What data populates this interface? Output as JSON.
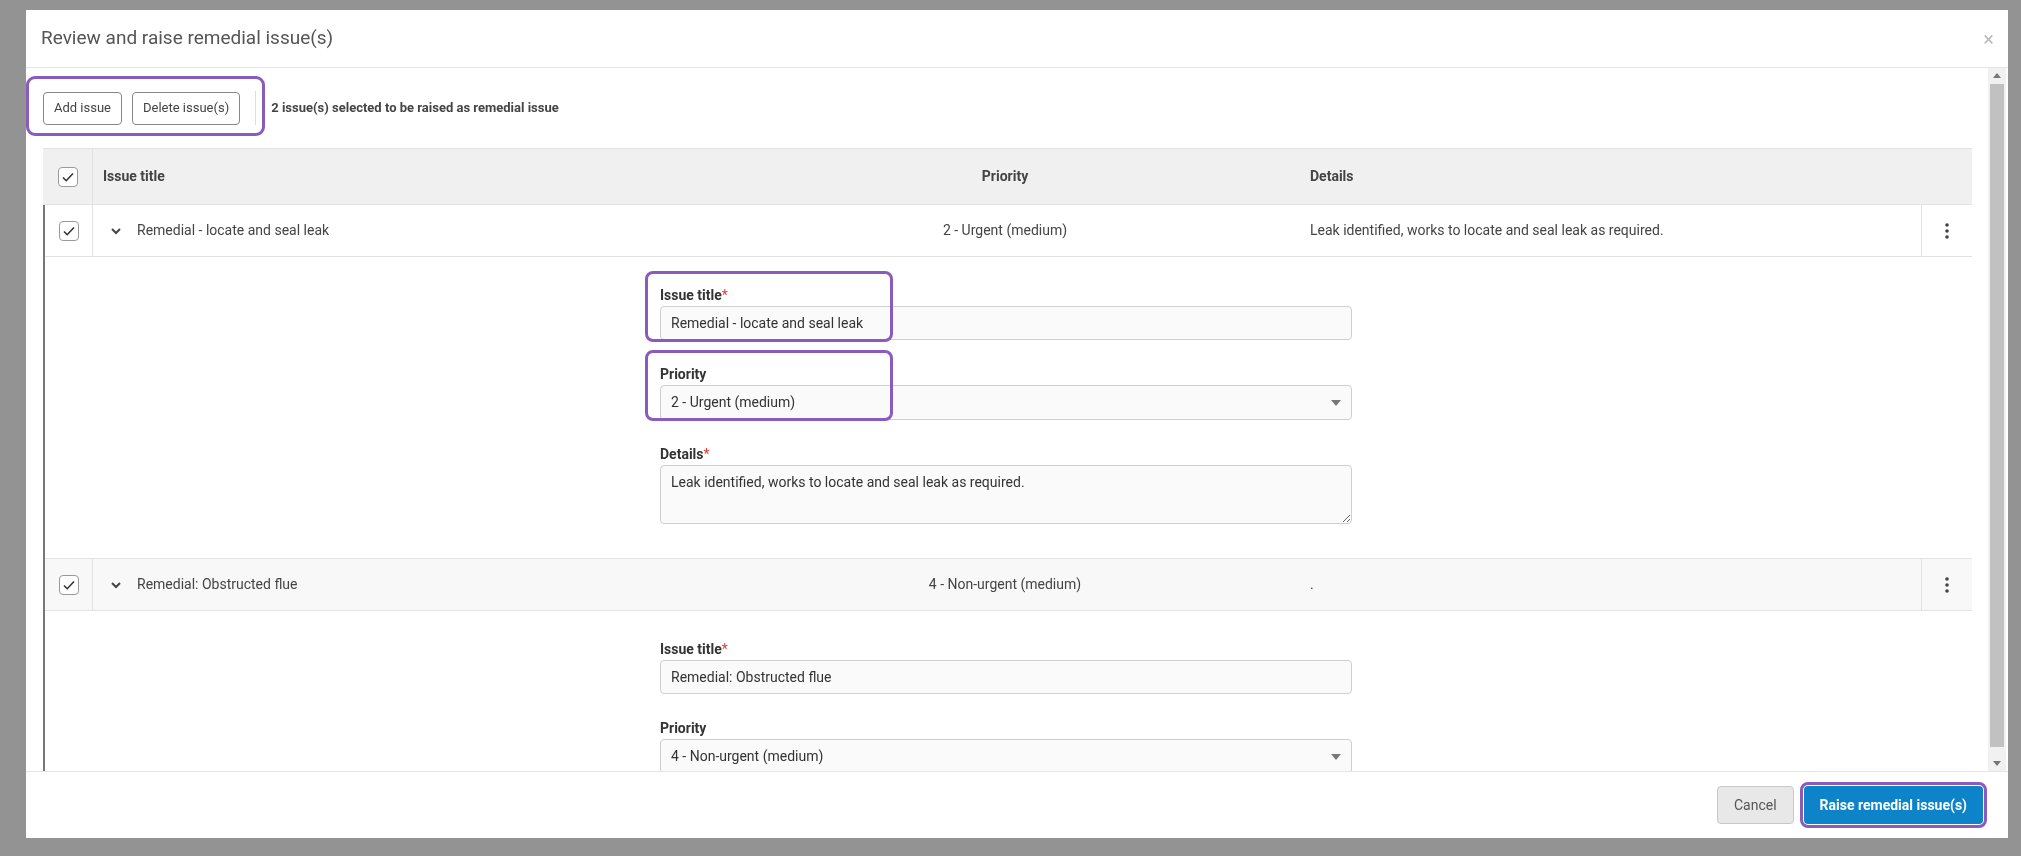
{
  "dialog": {
    "title": "Review and raise remedial issue(s)",
    "close": "×"
  },
  "toolbar": {
    "highlighted": true,
    "buttons": [
      "Add issue",
      "Delete issue(s)"
    ],
    "selection_note": "2 issue(s) selected to be raised as remedial issue"
  },
  "table": {
    "select_all_checked": true,
    "columns": [
      "Issue title",
      "Priority",
      "Details"
    ],
    "rows": [
      {
        "checked": true,
        "expanded": true,
        "title": "Remedial - locate and seal leak",
        "priority": "2 - Urgent (medium)",
        "details": "Leak identified, works to locate and seal leak as required.",
        "fields": [
          {
            "kind": "text",
            "label": "Issue title",
            "required_mark": "*",
            "highlighted": true,
            "value": "Remedial - locate and seal leak"
          },
          {
            "kind": "select",
            "label": "Priority",
            "highlighted": true,
            "value": "2 - Urgent (medium)"
          },
          {
            "kind": "textarea",
            "label": "Details",
            "required_mark": "*",
            "highlighted": false,
            "value": "Leak identified, works to locate and seal leak as required."
          }
        ]
      },
      {
        "checked": true,
        "expanded": true,
        "title": "Remedial: Obstructed flue",
        "priority": "4 - Non-urgent (medium)",
        "details": ".",
        "fields": [
          {
            "kind": "text",
            "label": "Issue title",
            "required_mark": "*",
            "highlighted": false,
            "value": "Remedial: Obstructed flue"
          },
          {
            "kind": "select",
            "label": "Priority",
            "highlighted": false,
            "value": "4 - Non-urgent (medium)"
          }
        ]
      }
    ]
  },
  "footer": {
    "buttons": [
      {
        "kind": "secondary",
        "label": "Cancel",
        "highlighted": false
      },
      {
        "kind": "primary",
        "label": "Raise remedial issue(s)",
        "highlighted": true
      }
    ]
  }
}
